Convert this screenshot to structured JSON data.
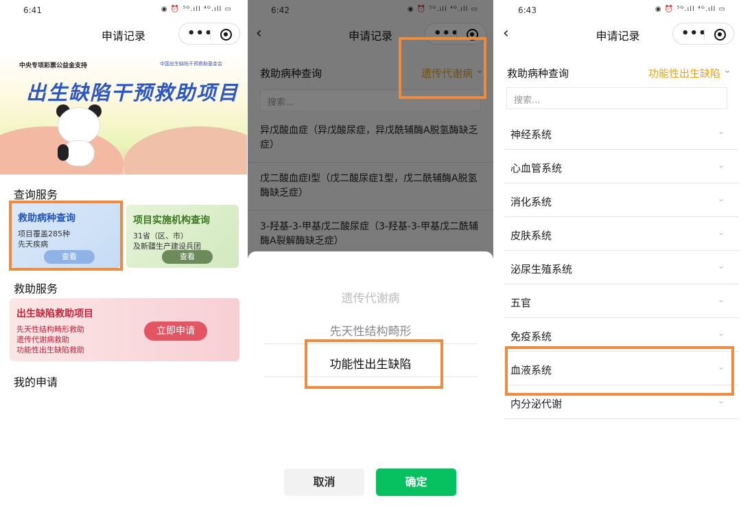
{
  "screens": {
    "home": {
      "status_time": "6:41",
      "status_icons": "◉ ⏰ ⁵ᴳ.ıll ⁴ᴳ.ıll ▭",
      "title": "申请记录",
      "banner": {
        "sponsor": "中央专项彩票公益金支持",
        "org": "中国出生缺陷干预救助基金会",
        "headline": "出生缺陷干预救助项目"
      },
      "query_section": "查询服务",
      "card_disease": {
        "title": "救助病种查询",
        "desc1": "项目覆盖285种",
        "desc2": "先天疾病",
        "button": "查看"
      },
      "card_institution": {
        "title": "项目实施机构查询",
        "desc1": "31省（区、市）",
        "desc2": "及新疆生产建设兵团",
        "button": "查看"
      },
      "aid_section": "救助服务",
      "card_aid": {
        "title": "出生缺陷救助项目",
        "line1": "先天性结构畸形救助",
        "line2": "遗传代谢病救助",
        "line3": "功能性出生缺陷救助",
        "button": "立即申请"
      },
      "my_apply": "我的申请"
    },
    "picker": {
      "status_time": "6:42",
      "status_icons": "◉ ⏰ ⁵ᴳ.ıll ⁴ᴳ.ıll ▭",
      "title": "申请记录",
      "filter_label": "救助病种查询",
      "filter_value": "遗传代谢病",
      "search_placeholder": "搜索...",
      "diseases": [
        "异戊酸血症（异戊酸尿症，异戊酰辅酶A脱氢酶缺乏症）",
        "戊二酸血症I型（戊二酸尿症1型，戊二酰辅酶A脱氢酶缺乏症）",
        "3-羟基-3-甲基戊二酸尿症（3-羟基-3-甲基戊二酰辅酶A裂解酶缺乏症）"
      ],
      "options": [
        "遗传代谢病",
        "先天性结构畸形",
        "功能性出生缺陷"
      ],
      "cancel": "取消",
      "confirm": "确定"
    },
    "categories": {
      "status_time": "6:43",
      "status_icons": "◉ ⏰ ⁵ᴳ.ıll ⁴ᴳ.ıll ▭",
      "title": "申请记录",
      "filter_label": "救助病种查询",
      "filter_value": "功能性出生缺陷",
      "search_placeholder": "搜索...",
      "items": [
        "神经系统",
        "心血管系统",
        "消化系统",
        "皮肤系统",
        "泌尿生殖系统",
        "五官",
        "免疫系统",
        "血液系统",
        "内分泌代谢"
      ]
    }
  },
  "colors": {
    "highlight": "#f08a3c",
    "accent_yellow": "#e3a51a",
    "confirm_green": "#07c160"
  },
  "icons": [
    "back-icon",
    "more-icon",
    "target-icon",
    "chevron-down-icon",
    "panda-mascot"
  ]
}
